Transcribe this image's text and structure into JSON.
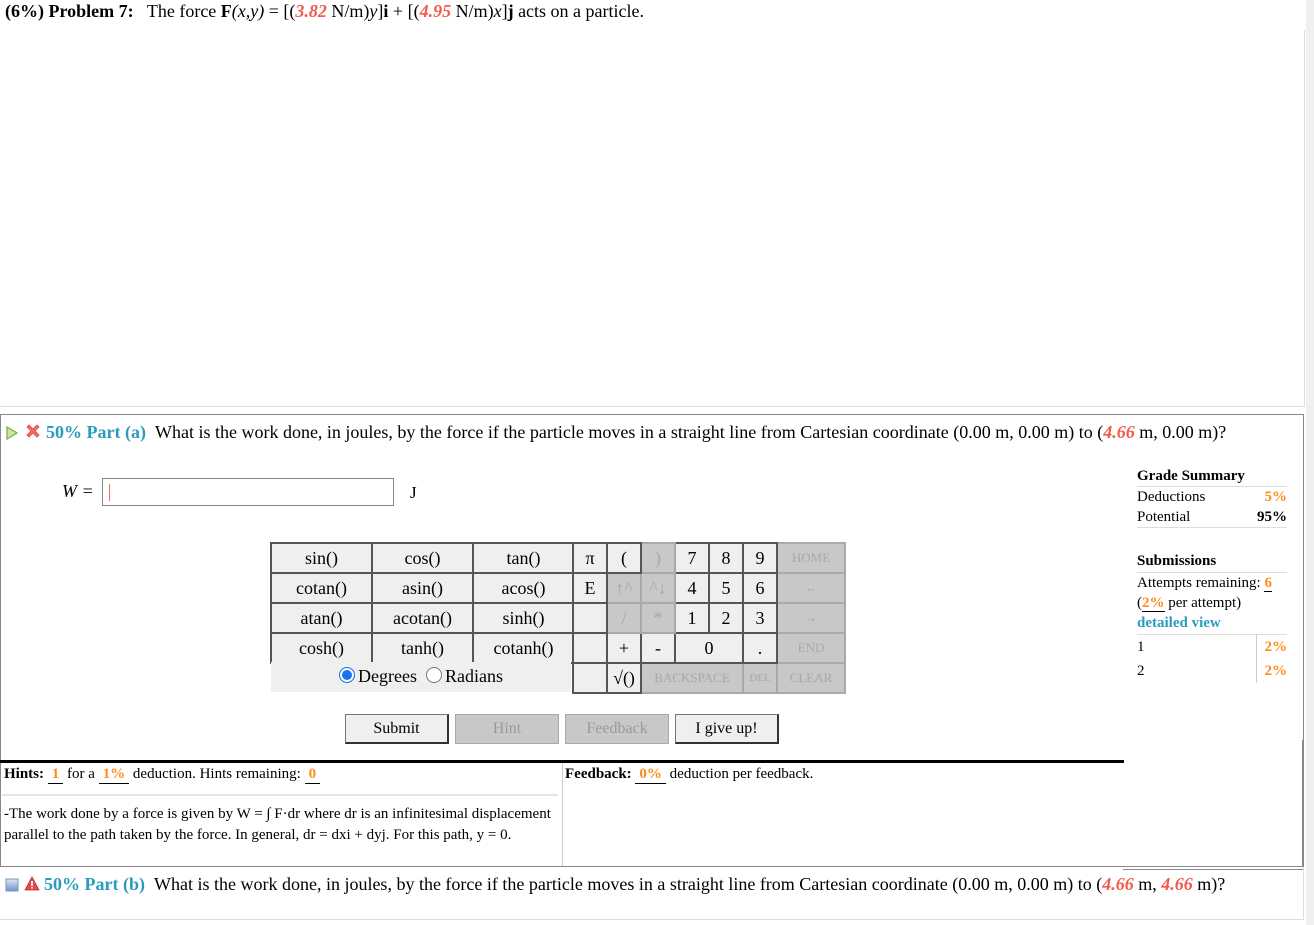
{
  "problem": {
    "weight": "(6%)",
    "label": "Problem 7:",
    "statement_pre": "The force",
    "force_symbol": "F",
    "force_args": "(x,y)",
    "eq": " = [(",
    "k1": "3.82",
    "unit1": " N/m)",
    "var1": "y",
    "vec_i": "i",
    "plus": " + [(",
    "k2": "4.95",
    "unit2": " N/m)",
    "var2": "x",
    "vec_j": "j",
    "statement_post": " acts on a particle."
  },
  "part_a": {
    "weight": "50%",
    "label": "Part (a)",
    "question_pre": "What is the work done, in joules, by the force if the particle moves in a straight line from Cartesian coordinate (0.00 m, 0.00 m) to (",
    "x_value": "4.66",
    "question_post": " m, 0.00 m)?",
    "answer_label": "W =",
    "answer_value": "",
    "answer_unit": "J"
  },
  "function_keys": [
    [
      "sin()",
      "cos()",
      "tan()"
    ],
    [
      "cotan()",
      "asin()",
      "acos()"
    ],
    [
      "atan()",
      "acotan()",
      "sinh()"
    ],
    [
      "cosh()",
      "tanh()",
      "cotanh()"
    ]
  ],
  "angle_mode": {
    "degrees_label": "Degrees",
    "radians_label": "Radians",
    "selected": "Degrees"
  },
  "number_keys": {
    "pi": "π",
    "open_paren": "(",
    "close_paren": ")",
    "seven": "7",
    "eight": "8",
    "nine": "9",
    "home": "HOME",
    "e": "E",
    "up": "↑^",
    "down": "^↓",
    "four": "4",
    "five": "5",
    "six": "6",
    "left": "←",
    "divide": "/",
    "multiply": "*",
    "one": "1",
    "two": "2",
    "three": "3",
    "right": "→",
    "plus": "+",
    "minus": "-",
    "zero": "0",
    "dot": ".",
    "end": "END",
    "sqrt": "√()",
    "backspace": "BACKSPACE",
    "del": "DEL",
    "clear": "CLEAR"
  },
  "buttons": {
    "submit": "Submit",
    "hint": "Hint",
    "feedback": "Feedback",
    "give_up": "I give up!"
  },
  "grade_summary": {
    "title": "Grade Summary",
    "deductions_label": "Deductions",
    "deductions_value": "5%",
    "potential_label": "Potential",
    "potential_value": "95%"
  },
  "submissions": {
    "title": "Submissions",
    "attempts_label": "Attempts remaining: ",
    "attempts_value": "6",
    "per_attempt_value": "2%",
    "per_attempt_label": " per attempt)",
    "detailed_view": "detailed view",
    "rows": [
      {
        "n": "1",
        "value": "2%"
      },
      {
        "n": "2",
        "value": "2%"
      }
    ]
  },
  "hints": {
    "label": "Hints:",
    "count": "1",
    "for_a": " for a ",
    "deduction": "1%",
    "deduction_label": " deduction. Hints remaining: ",
    "remaining": "0",
    "text": "-The work done by a force is given by W = ∫ F·dr where dr is an infinitesimal displacement parallel to the path taken by the force. In general, dr = dxi + dyj. For this path, y = 0."
  },
  "feedback": {
    "label": "Feedback:",
    "deduction": "0%",
    "deduction_label": " deduction per feedback."
  },
  "part_b": {
    "weight": "50%",
    "label": "Part (b)",
    "question_pre": "What is the work done, in joules, by the force if the particle moves in a straight line from Cartesian coordinate (0.00 m, 0.00 m) to (",
    "x_value": "4.66",
    "question_mid": " m, ",
    "y_value": "4.66",
    "question_post": " m)?"
  },
  "colors": {
    "accent_teal": "#2a9bbf",
    "highlight_orange": "#ff8c1a",
    "value_red": "#f05a4a"
  }
}
